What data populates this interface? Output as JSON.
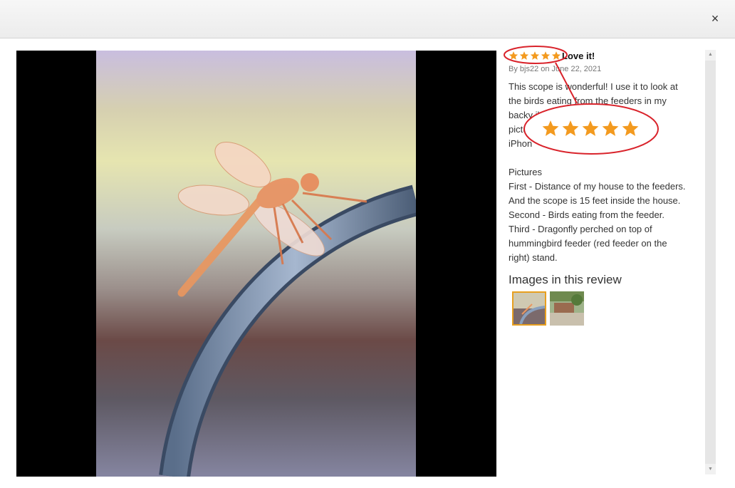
{
  "dialog": {
    "close_glyph": "×"
  },
  "review": {
    "rating": 5,
    "title": "Love it!",
    "byline": "By bjs22 on June 22, 2021",
    "body": "This scope is wonderful! I use it to look at\nthe birds eating from the feeders in my\nbacky          il videos and\npicture          or my\niPhon\n\nPictures\nFirst - Distance of my house to the feeders.\nAnd the scope is 15 feet inside the house.\nSecond - Birds eating from the feeder.\nThird - Dragonfly perched on top of\nhummingbird feeder (red feeder on the\nright) stand.",
    "images_heading": "Images in this review"
  },
  "thumbnails": [
    {
      "subject": "dragonfly",
      "selected": true
    },
    {
      "subject": "garden-feeders",
      "selected": false
    }
  ],
  "colors": {
    "star": "#f39a1f",
    "annotation": "#d9232b",
    "selected_border": "#e79f1f"
  },
  "icons": {
    "close": "close-icon",
    "star": "star-icon"
  }
}
